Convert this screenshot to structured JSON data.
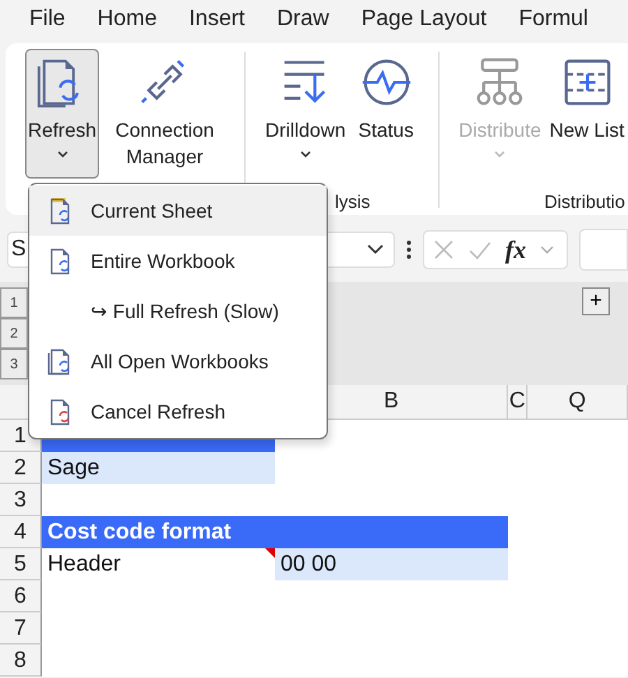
{
  "menu_tabs": [
    {
      "label": "File",
      "selected": false
    },
    {
      "label": "Home",
      "selected": false
    },
    {
      "label": "Insert",
      "selected": false
    },
    {
      "label": "Draw",
      "selected": false
    },
    {
      "label": "Page Layout",
      "selected": false
    },
    {
      "label": "Formul",
      "selected": false
    }
  ],
  "ribbon": {
    "buttons": [
      {
        "label": "Refresh",
        "kind": "refresh",
        "dropdown": true,
        "selected": true,
        "disabled": false
      },
      {
        "label": "Connection Manager",
        "kind": "link",
        "dropdown": false,
        "selected": false,
        "disabled": false
      },
      {
        "label": "Drilldown",
        "kind": "drilldown",
        "dropdown": true,
        "selected": false,
        "disabled": false
      },
      {
        "label": "Status",
        "kind": "status",
        "dropdown": false,
        "selected": false,
        "disabled": false
      },
      {
        "label": "Distribute",
        "kind": "tree",
        "dropdown": true,
        "selected": false,
        "disabled": true
      },
      {
        "label": "New List",
        "kind": "grid",
        "dropdown": false,
        "selected": false,
        "disabled": false
      }
    ],
    "group_labels": [
      "lysis",
      "Distributio"
    ]
  },
  "formula_bar": {
    "name_box": "S",
    "fx": "fx"
  },
  "outline": {
    "levels": [
      "1",
      "2",
      "3"
    ],
    "expand": "+"
  },
  "columns": [
    "B",
    "C",
    "Q"
  ],
  "rows": [
    {
      "number": "1",
      "cells": [
        {
          "kind": "header"
        }
      ]
    },
    {
      "number": "2",
      "cells": [
        {
          "text": "Sage",
          "kind": "value"
        }
      ]
    },
    {
      "number": "3",
      "cells": []
    },
    {
      "number": "4",
      "cells": [
        {
          "text": "Cost code format",
          "kind": "band"
        }
      ]
    },
    {
      "number": "5",
      "cells": [
        {
          "text": "Header",
          "kind": "plain",
          "comment": true
        },
        {
          "text": "00 00",
          "kind": "value"
        }
      ]
    },
    {
      "number": "6",
      "cells": []
    },
    {
      "number": "7",
      "cells": []
    },
    {
      "number": "8",
      "cells": []
    }
  ],
  "dropdown_menu": [
    {
      "label": "Current Sheet",
      "kind": "sheet",
      "selected": true
    },
    {
      "label": "Entire Workbook",
      "kind": "book",
      "selected": false
    },
    {
      "label": "↪ Full Refresh (Slow)",
      "kind": "sub",
      "selected": false
    },
    {
      "label": "All Open Workbooks",
      "kind": "books",
      "selected": false
    },
    {
      "label": "Cancel Refresh",
      "kind": "cancel",
      "selected": false
    }
  ]
}
